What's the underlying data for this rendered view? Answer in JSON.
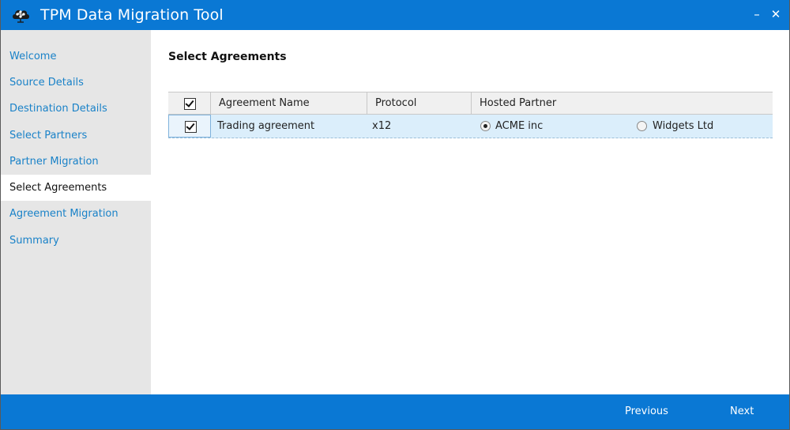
{
  "window": {
    "title": "TPM Data Migration Tool",
    "minimize_glyph": "–",
    "close_glyph": "✕",
    "icon": "network-cloud-icon"
  },
  "sidebar": {
    "items": [
      {
        "label": "Welcome",
        "active": false
      },
      {
        "label": "Source Details",
        "active": false
      },
      {
        "label": "Destination Details",
        "active": false
      },
      {
        "label": "Select Partners",
        "active": false
      },
      {
        "label": "Partner Migration",
        "active": false
      },
      {
        "label": "Select Agreements",
        "active": true
      },
      {
        "label": "Agreement Migration",
        "active": false
      },
      {
        "label": "Summary",
        "active": false
      }
    ]
  },
  "main": {
    "heading": "Select Agreements",
    "grid": {
      "header_checked": true,
      "columns": [
        "Agreement Name",
        "Protocol",
        "Hosted Partner"
      ],
      "rows": [
        {
          "checked": true,
          "agreement_name": "Trading agreement",
          "protocol": "x12",
          "hosted_partner_options": [
            {
              "label": "ACME inc",
              "selected": true
            },
            {
              "label": "Widgets Ltd",
              "selected": false
            }
          ]
        }
      ]
    }
  },
  "footer": {
    "previous_label": "Previous",
    "next_label": "Next"
  },
  "colors": {
    "accent": "#0a78d4",
    "nav_link": "#1a82c8",
    "sidebar_bg": "#e6e6e6",
    "row_selected_bg": "#dbeefb"
  }
}
